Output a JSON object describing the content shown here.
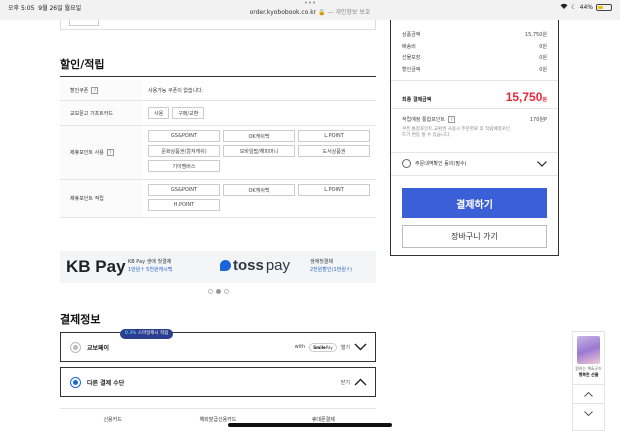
{
  "status_bar": {
    "time": "오후 5:05",
    "date": "9월 26일 월요일",
    "dots": "•••",
    "url": "order.kyobobook.co.kr",
    "privacy_text": "— 개인정보 보호",
    "battery": "44%",
    "battery_level": 0.44
  },
  "discount": {
    "title": "할인/적립",
    "coupon_label": "할인쿠폰",
    "coupon_value": "사용가능 쿠폰이 없습니다.",
    "giftcard_label": "교보문고 기프트카드",
    "giftcard_buttons": [
      "사용",
      "구매/교환"
    ],
    "partner_use_label": "제휴포인트 사용",
    "partner_use_buttons": [
      "GS&POINT",
      "OK캐쉬백",
      "L.POINT",
      "문화상품권(컬쳐캐쉬)",
      "모바일팝/해피머니",
      "도서상품권",
      "기아멤버스"
    ],
    "partner_earn_label": "제휴포인트 적립",
    "partner_earn_buttons": [
      "GS&POINT",
      "OK캐쉬백",
      "L.POINT",
      "H.POINT"
    ],
    "help_mark": "?"
  },
  "banner": {
    "kb_logo": "KB Pay",
    "kb_line1": "KB Pay 생애 첫결제",
    "kb_line2": "1만원↑ 5천원캐시백",
    "toss_logo_toss": "toss",
    "toss_logo_pay": "pay",
    "toss_line1": "생애첫결제",
    "toss_line2": "2천원할인(1만원↑)"
  },
  "payment": {
    "title": "결제정보",
    "badge_highlight": "0.3%",
    "badge_text": "스마일캐시 적립",
    "kyobo_pay": "교보페이",
    "with_text": "with",
    "smilepay_smile": "Smile",
    "smilepay_pay": "Pay",
    "expand_label": "열기",
    "other_methods": "다른 결제 수단",
    "collapse_label": "닫기",
    "tabs": [
      "신용카드",
      "해외발급신용카드",
      "휴대폰결제"
    ]
  },
  "summary": {
    "rows": [
      {
        "label": "상품금액",
        "value": "15,750원"
      },
      {
        "label": "배송비",
        "value": "0원"
      },
      {
        "label": "선물포장",
        "value": "0원"
      },
      {
        "label": "할인금액",
        "value": "0원"
      }
    ],
    "total_label": "최종 결제금액",
    "total_value": "15,750",
    "total_unit": "원",
    "points_label": "적립예정 통합포인트",
    "points_value": "170원P",
    "points_note": "쿠폰,통합포인트,교환권 사용시 주문완료 후 적립예정포인트가 변동 될 수 있습니다.",
    "agree_label": "주문내역확인 동의(필수)",
    "pay_button": "결제하기",
    "cart_button": "장바구니 가기"
  },
  "float_widget": {
    "line1": "원하는 책&굿즈",
    "line2": "행복한 선물"
  },
  "colors": {
    "accent_blue": "#3b5fd6",
    "total_red": "#e8263b",
    "badge_navy": "#2c3e91"
  }
}
